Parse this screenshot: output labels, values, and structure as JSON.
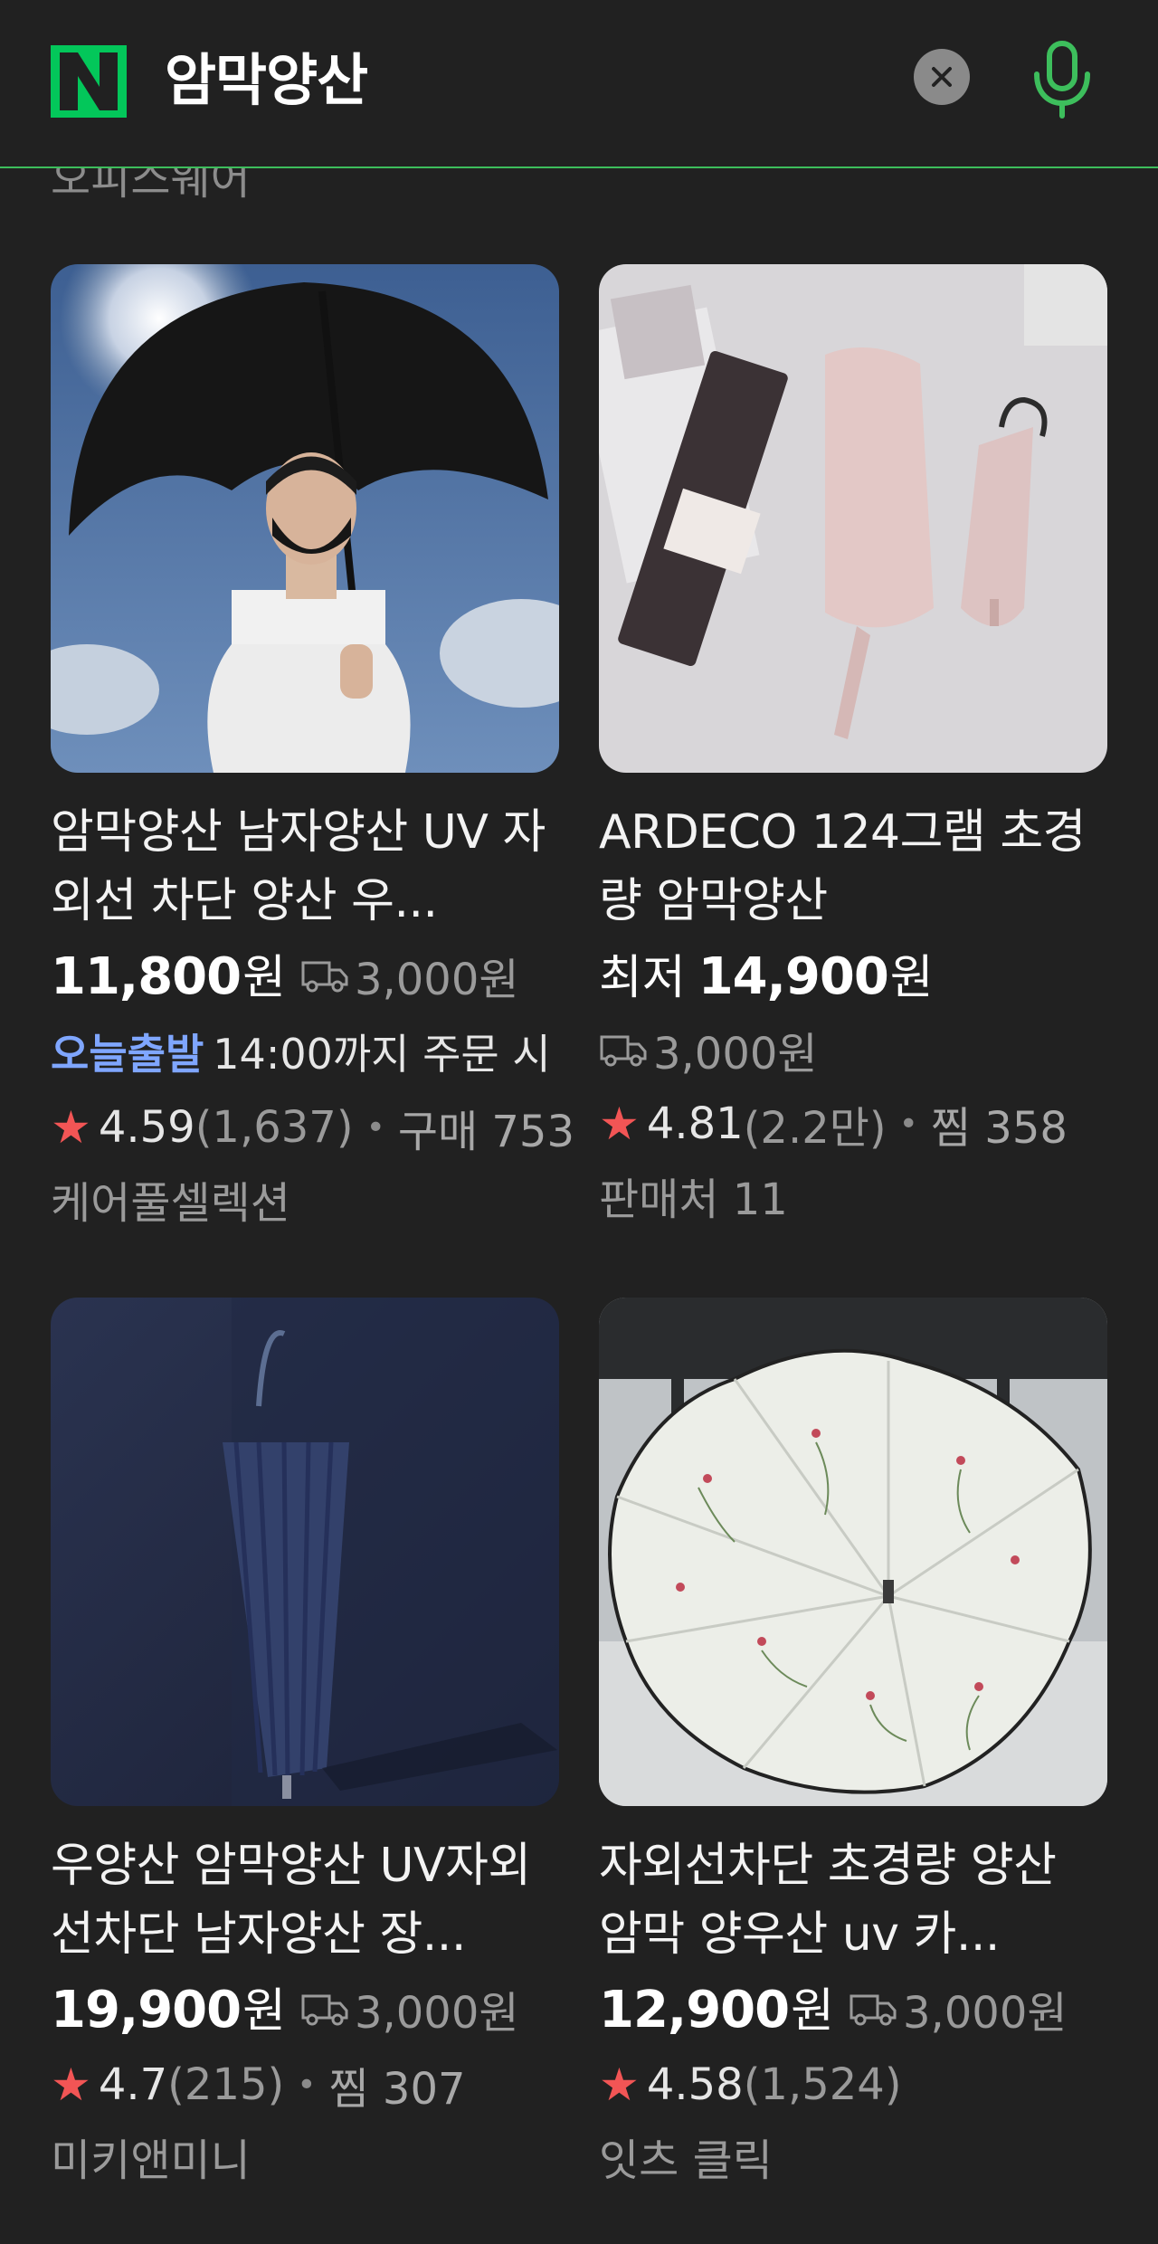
{
  "search": {
    "query": "암막양산",
    "logo_letter": "N",
    "brand_color": "#3dbe5c"
  },
  "cut_text": "오피스웨어",
  "products": [
    {
      "title": "암막양산 남자양산 UV 자외선 차단 양산 우산 겸용",
      "title_display": "암막양산 남자양산 UV 자외선 차단 양산 우...",
      "price": "11,800",
      "currency": "원",
      "shipping": "3,000원",
      "delivery_badge": "오늘출발",
      "delivery_deadline": "14:00까지 주문 시",
      "rating": "4.59",
      "review_count": "(1,637)",
      "extra_label": "구매 753",
      "seller": "케어풀셀렉션",
      "image": "man-black-umbrella"
    },
    {
      "title": "ARDECO 124그램 초경량 암막양산",
      "price_prefix": "최저",
      "price": "14,900",
      "currency": "원",
      "shipping": "3,000원",
      "rating": "4.81",
      "review_count": "(2.2만)",
      "extra_label": "찜 358",
      "seller": "판매처 11",
      "image": "pink-compact-umbrellas"
    },
    {
      "title": "우양산 암막양산 UV자외선차단 남자양산 장우산",
      "title_display": "우양산 암막양산 UV자외선차단 남자양산 장...",
      "price": "19,900",
      "currency": "원",
      "shipping": "3,000원",
      "rating": "4.7",
      "review_count": "(215)",
      "extra_label": "찜 307",
      "seller": "미키앤미니",
      "image": "navy-long-umbrella"
    },
    {
      "title": "자외선차단 초경량 양산 암막 양우산 uv 카네이션",
      "title_display": "자외선차단 초경량 양산 암막 양우산 uv 카...",
      "price": "12,900",
      "currency": "원",
      "shipping": "3,000원",
      "rating": "4.58",
      "review_count": "(1,524)",
      "seller": "잇츠 클릭",
      "image": "floral-umbrella"
    }
  ],
  "icons": {
    "clear": "close-icon",
    "voice": "microphone-icon",
    "shipping": "truck-icon",
    "rating": "star-icon"
  }
}
